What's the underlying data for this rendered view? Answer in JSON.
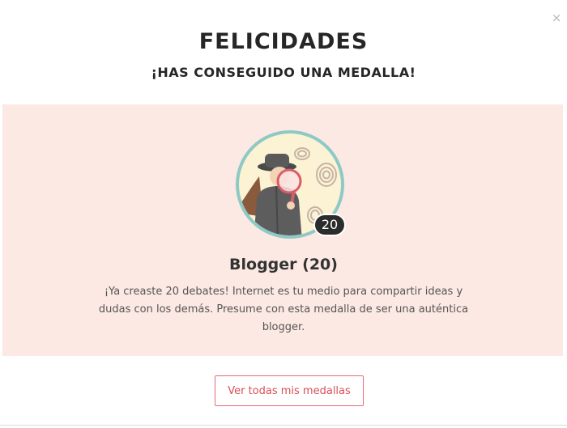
{
  "dialog": {
    "close_label": "×",
    "title": "FELICIDADES",
    "subtitle": "¡HAS CONSEGUIDO UNA MEDALLA!"
  },
  "medal": {
    "icon": "detective-with-magnifier-badge",
    "count": "20",
    "name": "Blogger (20)",
    "description": "¡Ya creaste 20 debates! Internet es tu medio para compartir ideas y dudas con los demás. Presume con esta medalla de ser una auténtica blogger."
  },
  "actions": {
    "view_all_label": "Ver todas mis medallas"
  },
  "colors": {
    "panel_bg": "#fce9e3",
    "badge_ring": "#8ec9c6",
    "badge_fill": "#fbf3d4",
    "accent": "#e56d73"
  }
}
